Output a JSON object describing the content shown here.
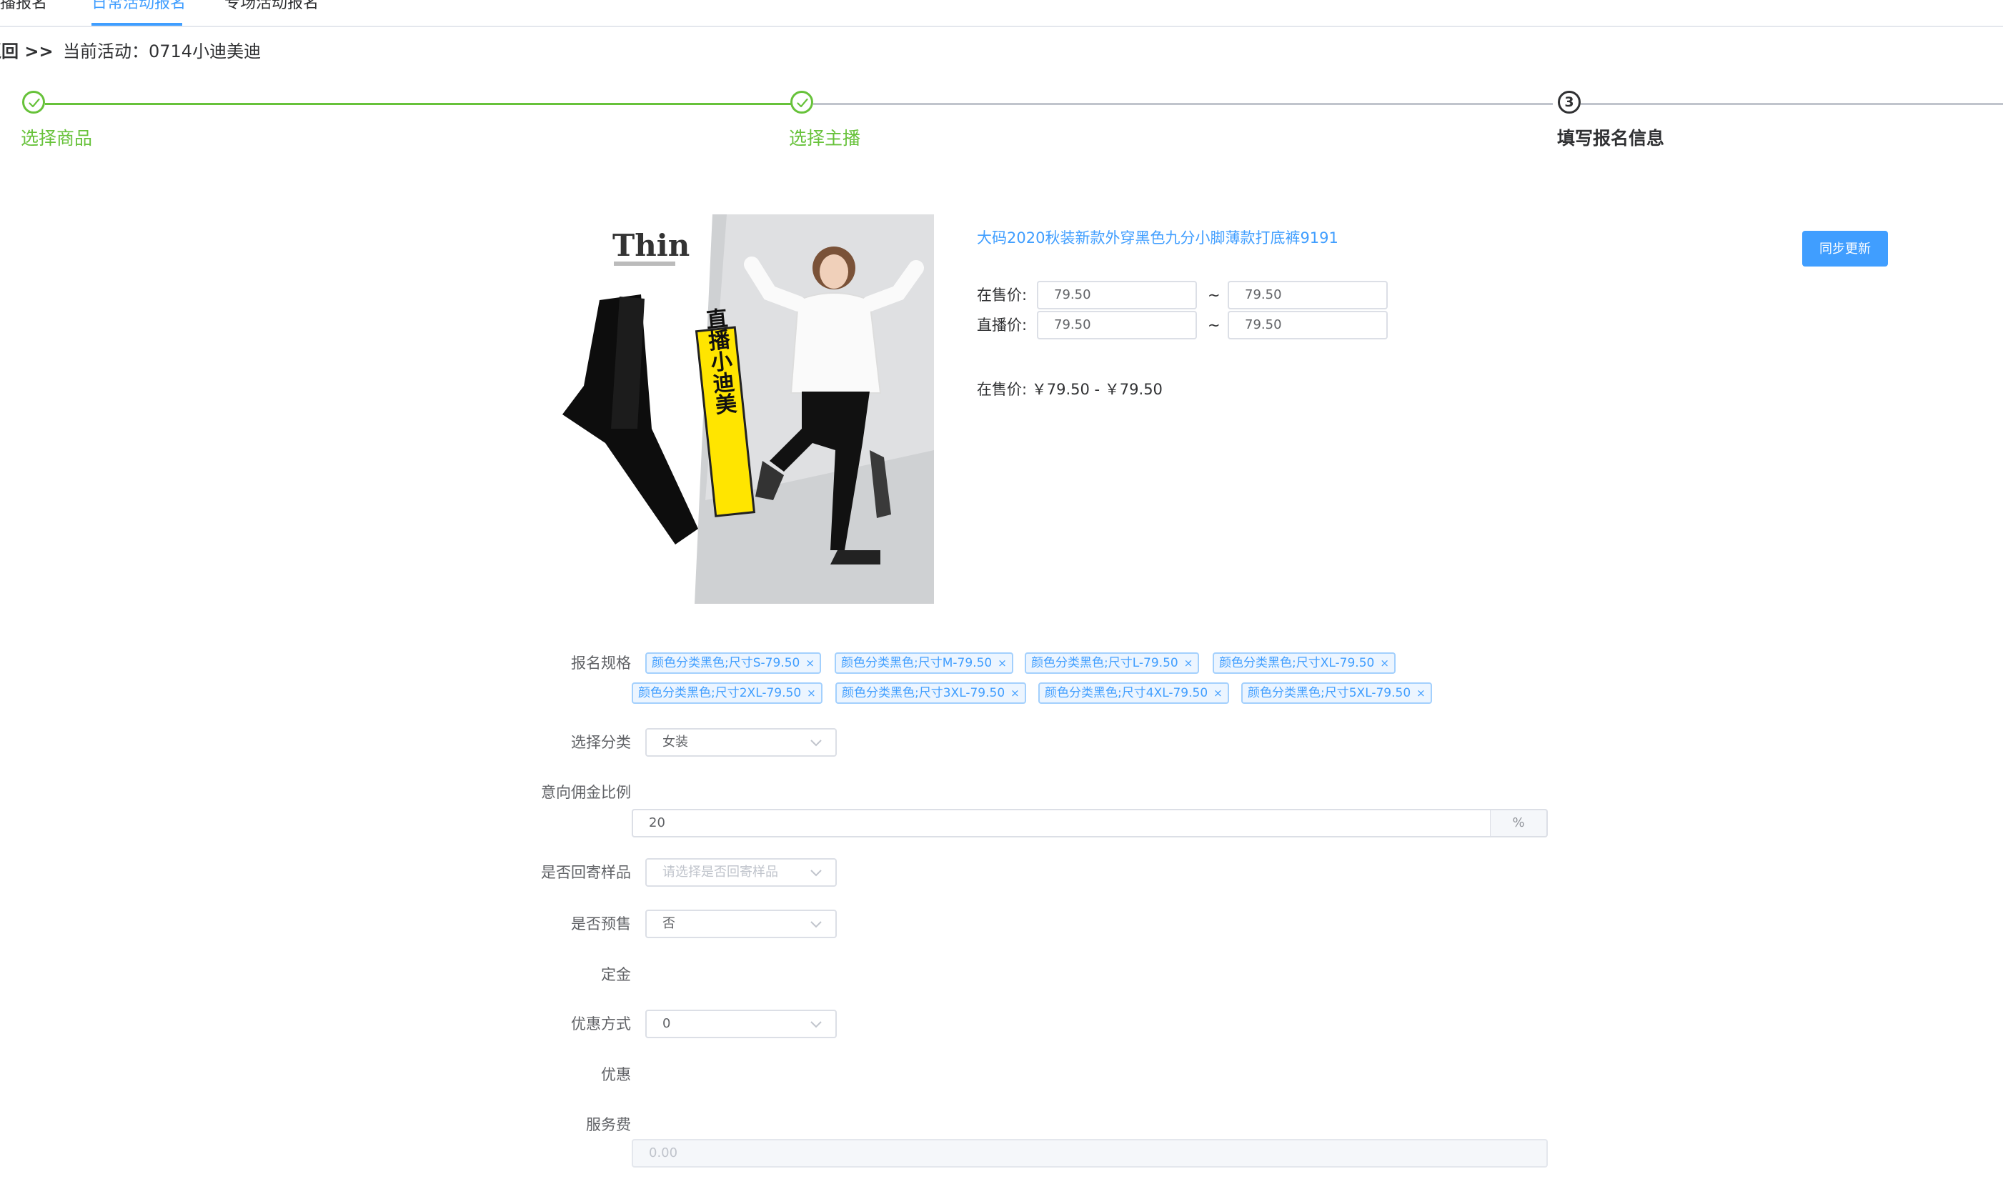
{
  "tabs": [
    {
      "label": "主播报名"
    },
    {
      "label": "日常活动报名",
      "active": true
    },
    {
      "label": "专场活动报名"
    }
  ],
  "breadcrumb": {
    "back": "返回 >>",
    "current": "当前活动：0714小迪美迪"
  },
  "steps": [
    {
      "label": "选择商品",
      "status": "done"
    },
    {
      "label": "选择主播",
      "status": "done"
    },
    {
      "label": "填写报名信息",
      "status": "current",
      "number": "3"
    }
  ],
  "product": {
    "title": "大码2020秋装新款外穿黑色九分小脚薄款打底裤9191",
    "sync_button": "同步更新",
    "price_rows": [
      {
        "label": "在售价:",
        "min": "79.50",
        "max": "79.50"
      },
      {
        "label": "直播价:",
        "min": "79.50",
        "max": "79.50"
      }
    ],
    "tilde": "~",
    "summary": "在售价: ￥79.50 - ￥79.50",
    "image": {
      "brand_mark": "Thin",
      "banner": "直播小迪美"
    }
  },
  "form": {
    "spec": {
      "label": "报名规格",
      "tags": [
        "颜色分类黑色;尺寸S-79.50",
        "颜色分类黑色;尺寸M-79.50",
        "颜色分类黑色;尺寸L-79.50",
        "颜色分类黑色;尺寸XL-79.50",
        "颜色分类黑色;尺寸2XL-79.50",
        "颜色分类黑色;尺寸3XL-79.50",
        "颜色分类黑色;尺寸4XL-79.50",
        "颜色分类黑色;尺寸5XL-79.50"
      ],
      "close_glyph": "×"
    },
    "category": {
      "label": "选择分类",
      "value": "女装"
    },
    "commission": {
      "label": "意向佣金比例",
      "value": "20",
      "suffix": "%"
    },
    "return_sample": {
      "label": "是否回寄样品",
      "placeholder": "请选择是否回寄样品"
    },
    "presale": {
      "label": "是否预售",
      "value": "否"
    },
    "deposit": {
      "label": "定金"
    },
    "discount_method": {
      "label": "优惠方式",
      "value": "0"
    },
    "discount": {
      "label": "优惠"
    },
    "service_fee": {
      "label": "服务费",
      "placeholder": "0.00"
    }
  },
  "colors": {
    "primary": "#409eff",
    "success": "#67c23a",
    "border": "#dcdfe6",
    "text": "#303133"
  }
}
